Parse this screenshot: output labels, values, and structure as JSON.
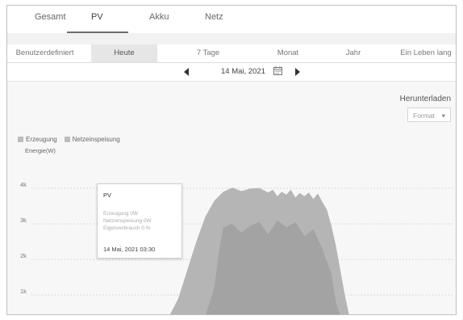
{
  "tabs": [
    {
      "label": "Gesamt"
    },
    {
      "label": "PV"
    },
    {
      "label": "Akku"
    },
    {
      "label": "Netz"
    }
  ],
  "active_tab": "PV",
  "periods": [
    {
      "label": "Benutzerdefiniert"
    },
    {
      "label": "Heute"
    },
    {
      "label": "7 Tage"
    },
    {
      "label": "Monat"
    },
    {
      "label": "Jahr"
    },
    {
      "label": "Ein Leben lang"
    }
  ],
  "active_period": "Heute",
  "date": "14 Mai, 2021",
  "download": {
    "label": "Herunterladen",
    "format_label": "Format"
  },
  "legend": [
    {
      "label": "Erzeugung",
      "color": "#bdbdbd"
    },
    {
      "label": "Netzeinspeisung",
      "color": "#bdbdbd"
    }
  ],
  "y_axis_label": "Energie(W)",
  "tooltip": {
    "title": "PV",
    "lines": [
      "Erzeugung 0W",
      "Netzeinspeisung 0W",
      "Eigenverbrauch 0 %"
    ],
    "time": "14 Mai, 2021 03:30"
  },
  "colors": {
    "erzeugung_fill": "#b5b5b5",
    "netzeinspeisung_fill": "#a3a3a3",
    "background": "#f7f7f7"
  },
  "chart_data": {
    "type": "area",
    "ylabel": "Energie(W)",
    "y_ticks": [
      "1k",
      "2k",
      "3k",
      "4k"
    ],
    "ylim": [
      0,
      4600
    ],
    "grid": true,
    "series": [
      {
        "name": "Erzeugung",
        "points": [
          [
            0.34,
            0
          ],
          [
            0.36,
            300
          ],
          [
            0.38,
            900
          ],
          [
            0.4,
            1700
          ],
          [
            0.42,
            2500
          ],
          [
            0.44,
            3200
          ],
          [
            0.46,
            3650
          ],
          [
            0.48,
            3900
          ],
          [
            0.5,
            4020
          ],
          [
            0.52,
            3920
          ],
          [
            0.54,
            3990
          ],
          [
            0.56,
            4010
          ],
          [
            0.58,
            3880
          ],
          [
            0.59,
            3960
          ],
          [
            0.6,
            3780
          ],
          [
            0.61,
            3900
          ],
          [
            0.62,
            3820
          ],
          [
            0.63,
            3960
          ],
          [
            0.64,
            3740
          ],
          [
            0.65,
            3870
          ],
          [
            0.66,
            3780
          ],
          [
            0.67,
            3880
          ],
          [
            0.68,
            3700
          ],
          [
            0.69,
            3850
          ],
          [
            0.7,
            3620
          ],
          [
            0.71,
            3400
          ],
          [
            0.72,
            2950
          ],
          [
            0.73,
            2400
          ],
          [
            0.74,
            1700
          ],
          [
            0.75,
            1000
          ],
          [
            0.76,
            400
          ],
          [
            0.77,
            0
          ]
        ]
      },
      {
        "name": "Netzeinspeisung",
        "points": [
          [
            0.44,
            0
          ],
          [
            0.46,
            1200
          ],
          [
            0.47,
            2200
          ],
          [
            0.48,
            2900
          ],
          [
            0.5,
            3000
          ],
          [
            0.52,
            2750
          ],
          [
            0.54,
            2950
          ],
          [
            0.56,
            3050
          ],
          [
            0.58,
            2700
          ],
          [
            0.6,
            3100
          ],
          [
            0.62,
            2900
          ],
          [
            0.64,
            3050
          ],
          [
            0.66,
            2650
          ],
          [
            0.68,
            2850
          ],
          [
            0.7,
            2300
          ],
          [
            0.72,
            1600
          ],
          [
            0.73,
            800
          ],
          [
            0.74,
            0
          ]
        ]
      }
    ]
  }
}
